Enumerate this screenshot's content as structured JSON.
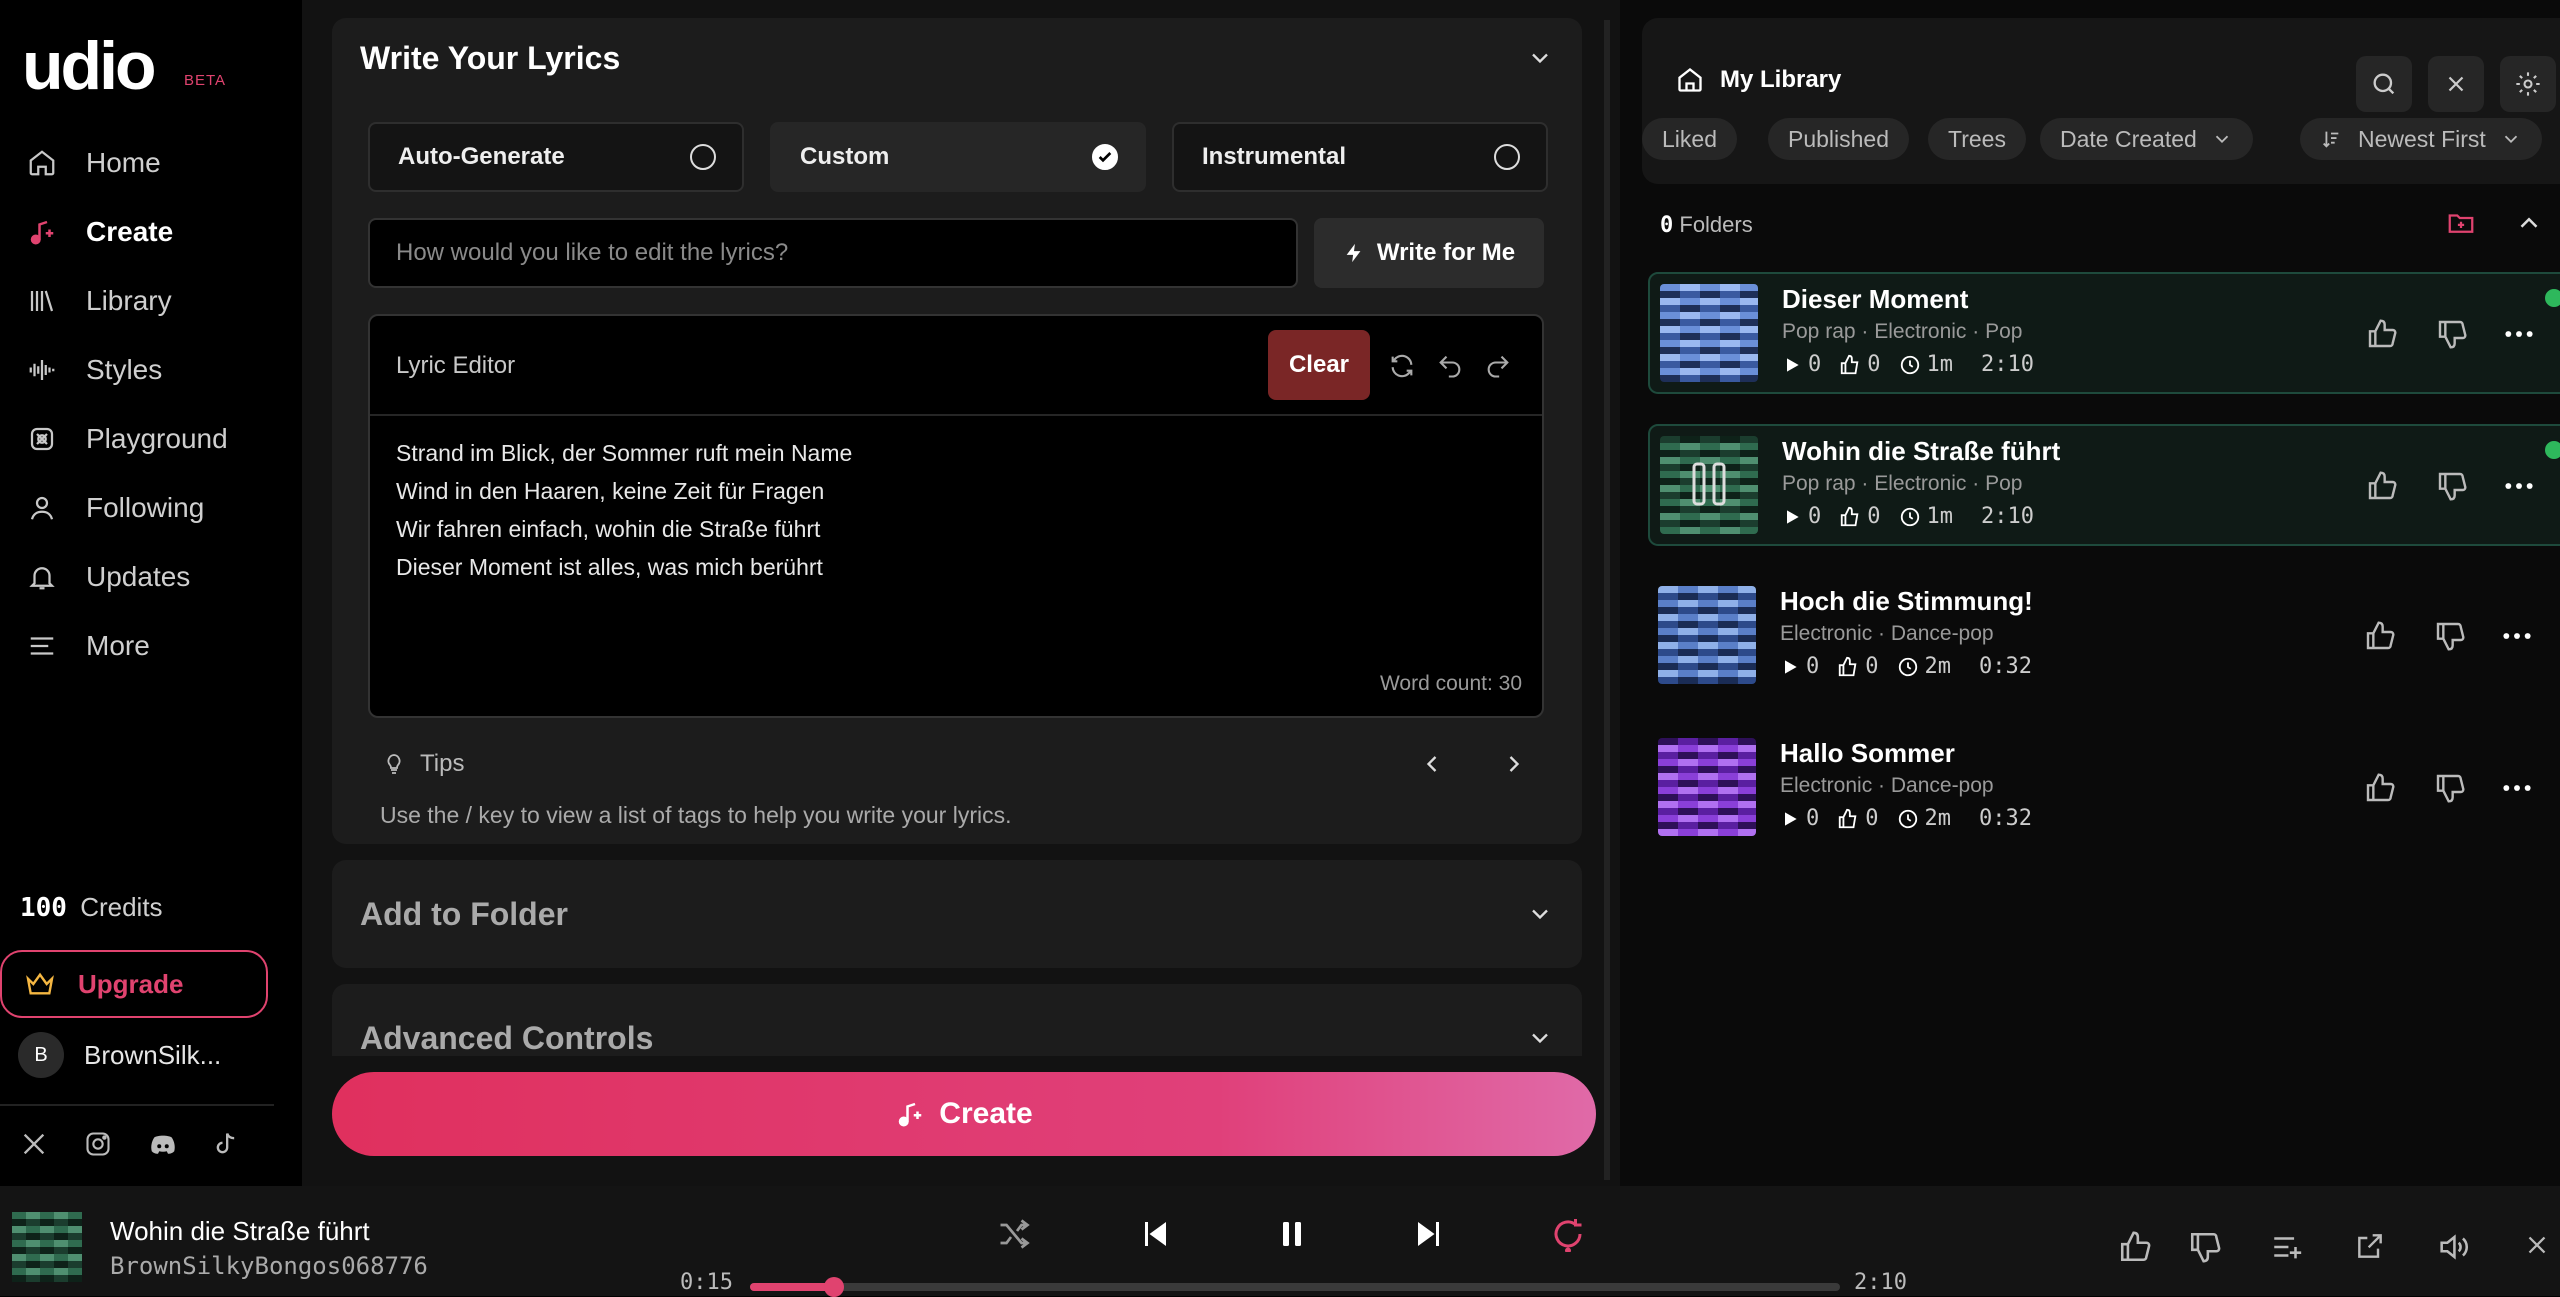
{
  "brand": {
    "logo": "udio",
    "badge": "BETA"
  },
  "nav": [
    {
      "label": "Home",
      "icon": "home-icon"
    },
    {
      "label": "Create",
      "icon": "music-plus-icon",
      "active": true
    },
    {
      "label": "Library",
      "icon": "library-icon"
    },
    {
      "label": "Styles",
      "icon": "waveform-icon"
    },
    {
      "label": "Playground",
      "icon": "playground-icon"
    },
    {
      "label": "Following",
      "icon": "user-icon"
    },
    {
      "label": "Updates",
      "icon": "bell-icon"
    },
    {
      "label": "More",
      "icon": "menu-icon"
    }
  ],
  "credits": {
    "count": "100",
    "label": "Credits"
  },
  "upgrade": {
    "label": "Upgrade"
  },
  "user": {
    "initial": "B",
    "name": "BrownSilk..."
  },
  "lyrics_panel": {
    "title": "Write Your Lyrics",
    "options": [
      {
        "label": "Auto-Generate",
        "selected": false
      },
      {
        "label": "Custom",
        "selected": true
      },
      {
        "label": "Instrumental",
        "selected": false
      }
    ],
    "prompt_placeholder": "How would you like to edit the lyrics?",
    "write_for_me": "Write for Me",
    "editor_label": "Lyric Editor",
    "clear_label": "Clear",
    "lyrics": [
      "Strand im Blick, der Sommer ruft mein Name",
      "Wind in den Haaren, keine Zeit für Fragen",
      "Wir fahren einfach, wohin die Straße führt",
      "Dieser Moment ist alles, was mich berührt"
    ],
    "word_count": "Word count: 30",
    "tips_label": "Tips",
    "tip_text": "Use the / key to view a list of tags to help you write your lyrics."
  },
  "add_folder": {
    "title": "Add to Folder"
  },
  "advanced": {
    "title": "Advanced Controls"
  },
  "create_button": "Create",
  "library": {
    "title": "My Library",
    "filters": [
      "Liked",
      "Published",
      "Trees",
      "Date Created"
    ],
    "sort": "Newest First",
    "folders_count": "0",
    "folders_label": "Folders",
    "tracks": [
      {
        "title": "Dieser Moment",
        "genres": [
          "Pop rap",
          "Electronic",
          "Pop"
        ],
        "plays": "0",
        "likes": "0",
        "age": "1m",
        "duration": "2:10",
        "highlighted": true,
        "colors": [
          "#6a8fd8",
          "#3a5aa0",
          "#9ab8f0",
          "#1e2f58"
        ]
      },
      {
        "title": "Wohin die Straße führt",
        "genres": [
          "Pop rap",
          "Electronic",
          "Pop"
        ],
        "plays": "0",
        "likes": "0",
        "age": "1m",
        "duration": "2:10",
        "highlighted": true,
        "playing": true,
        "colors": [
          "#2f6b4f",
          "#1b3d2e",
          "#4f8f70",
          "#0e2219"
        ]
      },
      {
        "title": "Hoch die Stimmung!",
        "genres": [
          "Electronic",
          "Dance-pop"
        ],
        "plays": "0",
        "likes": "0",
        "age": "2m",
        "duration": "0:32",
        "highlighted": false,
        "colors": [
          "#5a7fc8",
          "#2d4a8a",
          "#8fb0e8",
          "#1a2c55"
        ]
      },
      {
        "title": "Hallo Sommer",
        "genres": [
          "Electronic",
          "Dance-pop"
        ],
        "plays": "0",
        "likes": "0",
        "age": "2m",
        "duration": "0:32",
        "highlighted": false,
        "colors": [
          "#8a3fd8",
          "#5a1fa0",
          "#b070f0",
          "#2e1058"
        ]
      }
    ]
  },
  "player": {
    "title": "Wohin die Straße führt",
    "artist": "BrownSilkyBongos068776",
    "elapsed": "0:15",
    "total": "2:10",
    "progress": 0.077
  },
  "colors": {
    "accent": "#e0436f",
    "bg": "#000000",
    "panel": "#1c1c1c"
  }
}
